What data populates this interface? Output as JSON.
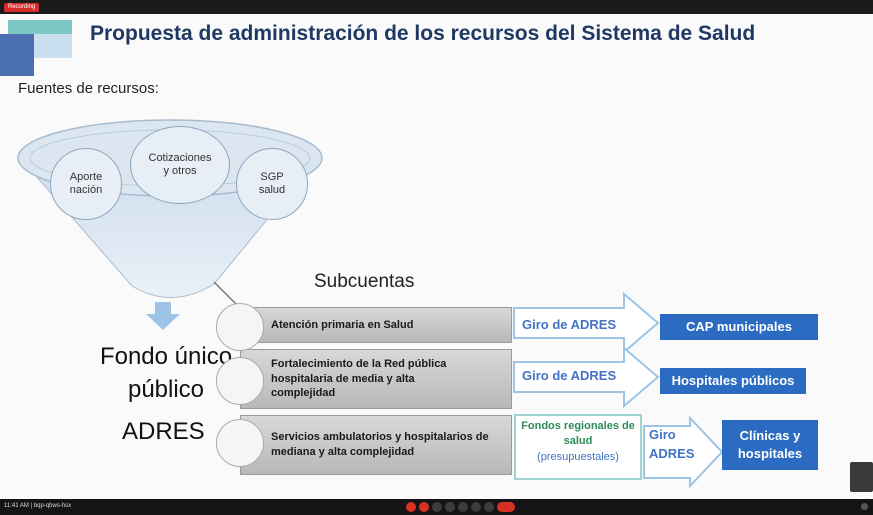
{
  "recording_badge": "Recording",
  "slide": {
    "title": "Propuesta de administración de los recursos del Sistema de Salud",
    "sources_label": "Fuentes de recursos:",
    "sources": [
      {
        "label": "Aporte\nnación"
      },
      {
        "label": "Cotizaciones\ny otros"
      },
      {
        "label": "SGP\nsalud"
      }
    ],
    "fondo_unico": "Fondo único\npúblico",
    "adres": "ADRES",
    "subcuentas_title": "Subcuentas",
    "subcuentas": [
      {
        "label": "Atención primaria en Salud"
      },
      {
        "label": "Fortalecimiento de la Red pública hospitalaria de media y alta complejidad"
      },
      {
        "label": "Servicios ambulatorios y hospitalarios de mediana y alta complejidad"
      }
    ],
    "giro_adres_1": "Giro de ADRES",
    "giro_adres_2": "Giro de ADRES",
    "fondos_regionales": "Fondos regionales de salud",
    "fondos_regionales_sub": "(presupuestales)",
    "giro_adres_3": "Giro\nADRES",
    "destinations": [
      {
        "label": "CAP municipales"
      },
      {
        "label": "Hospitales públicos"
      },
      {
        "label": "Clínicas y\nhospitales"
      }
    ]
  },
  "colors": {
    "title": "#1f3864",
    "accent_blue": "#2b6bc1",
    "giro_text": "#4472c4",
    "fondos_green": "#2e8b57",
    "record_red": "#d62b2b"
  },
  "bottombar": {
    "meeting_info": "11:41 AM | bqp-qbws-hsx"
  },
  "icons": [
    "recording-icon",
    "mic-icon",
    "camera-icon",
    "present-icon",
    "more-icon",
    "end-call-icon"
  ]
}
